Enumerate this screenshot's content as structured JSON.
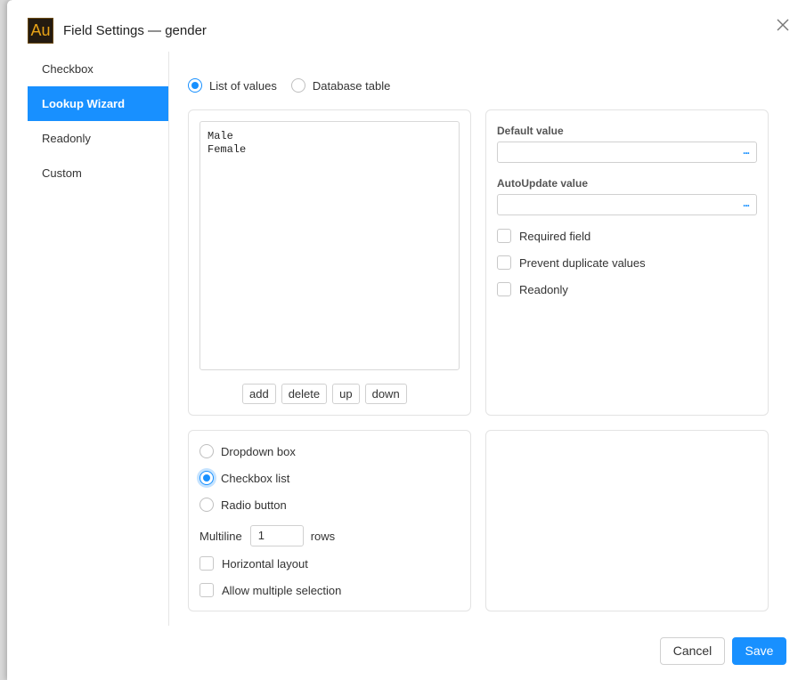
{
  "window": {
    "title": "Field Settings — gender",
    "logo_text": "Au",
    "close_icon": "close-icon"
  },
  "sidebar": {
    "items": [
      {
        "label": "Checkbox",
        "active": false
      },
      {
        "label": "Lookup Wizard",
        "active": true
      },
      {
        "label": "Readonly",
        "active": false
      },
      {
        "label": "Custom",
        "active": false
      }
    ]
  },
  "source": {
    "list_label": "List of values",
    "table_label": "Database table",
    "selected": "list"
  },
  "values_list": {
    "text": "Male\nFemale",
    "buttons": {
      "add": "add",
      "delete": "delete",
      "up": "up",
      "down": "down"
    }
  },
  "defaults": {
    "default_label": "Default value",
    "default_value": "",
    "autoupdate_label": "AutoUpdate value",
    "autoupdate_value": "",
    "picker_glyph": "...",
    "required_label": "Required field",
    "required_checked": false,
    "prevent_dup_label": "Prevent duplicate values",
    "prevent_dup_checked": false,
    "readonly_label": "Readonly",
    "readonly_checked": false
  },
  "display": {
    "dropdown_label": "Dropdown box",
    "checkbox_list_label": "Checkbox list",
    "radio_label": "Radio button",
    "selected": "checkbox_list",
    "multiline_label": "Multiline",
    "multiline_value": "1",
    "rows_label": "rows",
    "horizontal_label": "Horizontal layout",
    "horizontal_checked": false,
    "multi_select_label": "Allow multiple selection",
    "multi_select_checked": false
  },
  "footer": {
    "cancel_label": "Cancel",
    "save_label": "Save"
  },
  "colors": {
    "accent": "#1890ff",
    "logo_bg": "#241b10",
    "logo_fg": "#e8a317"
  }
}
